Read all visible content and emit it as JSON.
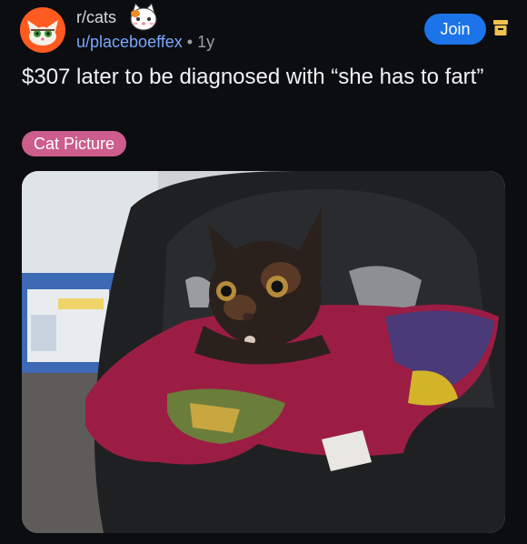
{
  "post": {
    "subreddit": "r/cats",
    "author": "u/placeboeffex",
    "separator": "•",
    "age": "1y",
    "join_label": "Join",
    "title": "$307 later to be diagnosed with “she has to fart”",
    "flair": "Cat Picture"
  },
  "colors": {
    "background": "#0b0d10",
    "join_button": "#1d73e8",
    "flair": "#cc5d8c",
    "username": "#7aa7ff",
    "archive_icon": "#f2c14e"
  },
  "icons": {
    "avatar": "cat-avatar-icon",
    "subreddit_badge": "cat-face-icon",
    "archive": "archive-icon"
  }
}
